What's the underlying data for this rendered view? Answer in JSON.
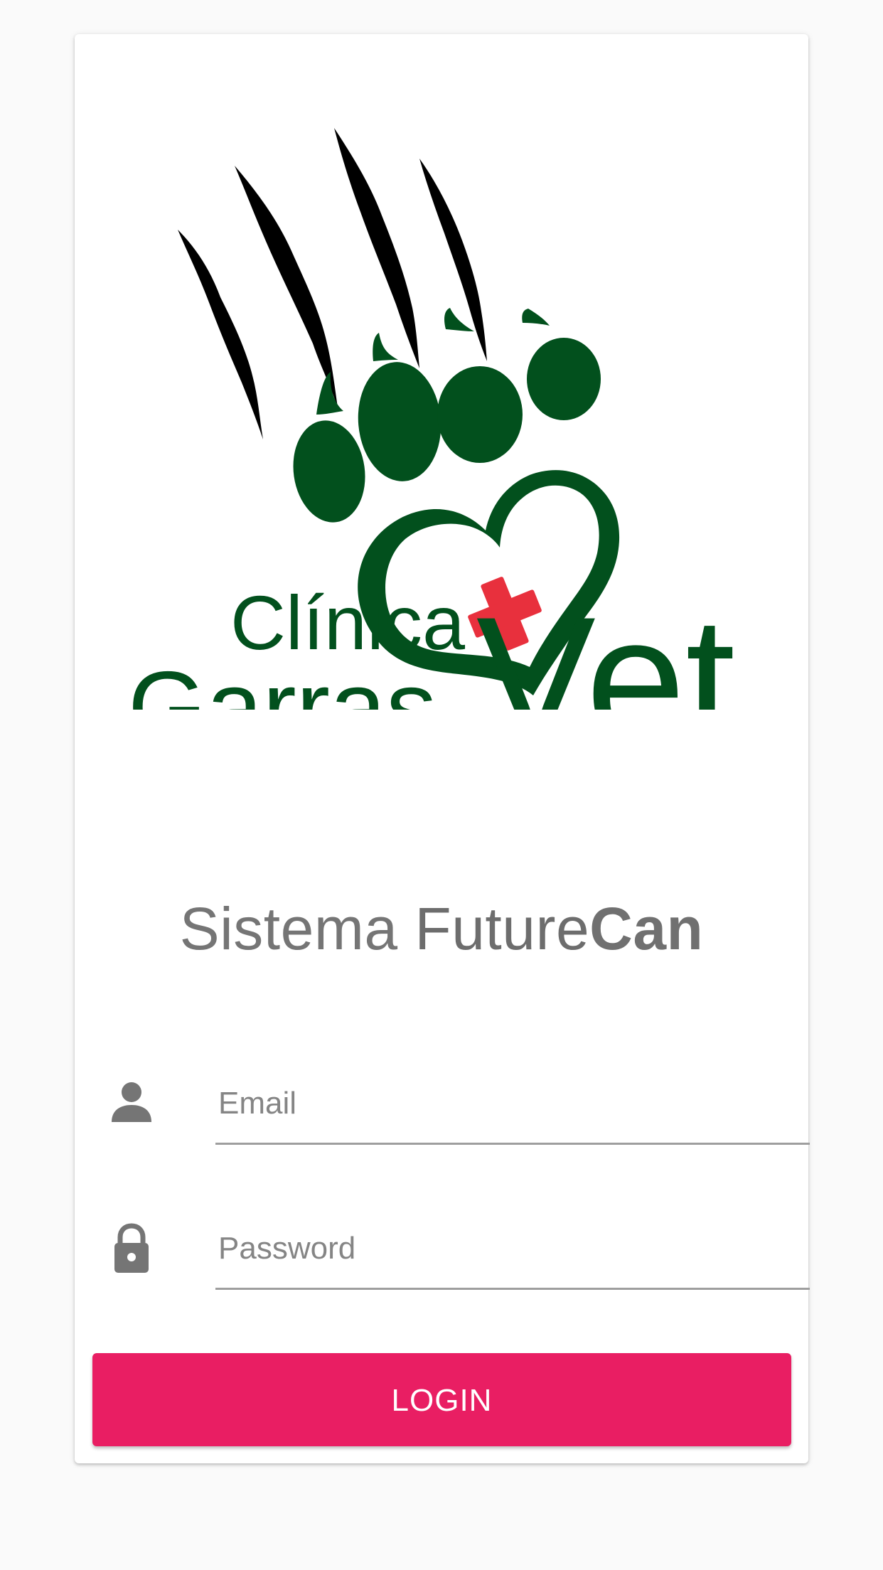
{
  "logo": {
    "line1": "Clínica",
    "line2_left": "Garras",
    "line2_right": "Vet",
    "brand_green": "#02501d",
    "cross_red": "#e8303d"
  },
  "subtitle": {
    "part1": "Sistema ",
    "part2": "Future",
    "part3": "Can"
  },
  "form": {
    "email_placeholder": "Email",
    "password_placeholder": "Password",
    "email_icon": "person-icon",
    "password_icon": "lock-icon"
  },
  "login_button": {
    "label": "LOGIN",
    "color": "#e91e63"
  }
}
